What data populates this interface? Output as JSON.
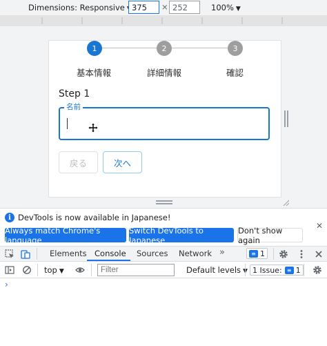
{
  "device_toolbar": {
    "dimensions_label": "Dimensions: Responsive",
    "width_value": "375",
    "separator": "×",
    "height_value": "252",
    "zoom_label": "100%"
  },
  "stepper": {
    "steps": [
      {
        "number": "1",
        "label": "基本情報",
        "active": true
      },
      {
        "number": "2",
        "label": "詳細情報",
        "active": false
      },
      {
        "number": "3",
        "label": "確認",
        "active": false
      }
    ],
    "active_color": "#1976d2",
    "inactive_color": "#9e9e9e"
  },
  "form": {
    "step_title": "Step 1",
    "name_label": "名前",
    "name_value": "",
    "back_label": "戻る",
    "next_label": "次へ"
  },
  "infobar": {
    "message": "DevTools is now available in Japanese!",
    "match_language_label": "Always match Chrome's language",
    "switch_label": "Switch DevTools to Japanese",
    "dont_show_label": "Don't show again",
    "close_glyph": "✕"
  },
  "devtools_tabs": {
    "tabs": [
      "Elements",
      "Console",
      "Sources",
      "Network"
    ],
    "active_tab": "Console",
    "more_glyph": "»",
    "message_count": "1"
  },
  "console_toolbar": {
    "context": "top",
    "filter_placeholder": "Filter",
    "levels_label": "Default levels",
    "issues_label": "1 Issue:",
    "issues_count": "1",
    "prompt_glyph": "›"
  },
  "colors": {
    "accent": "#1a73e8",
    "material_primary": "#1976d2"
  }
}
